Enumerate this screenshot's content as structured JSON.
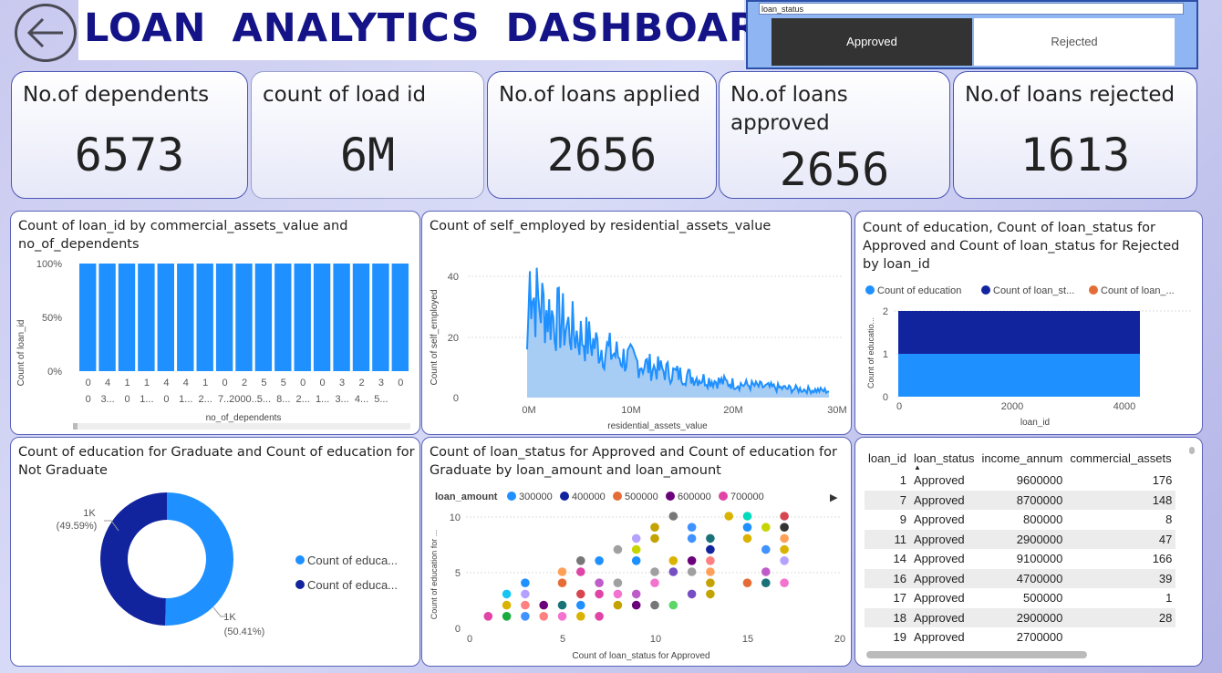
{
  "header": {
    "title": "LOAN  ANALYTICS  DASHBOARD",
    "back_icon": "back-arrow-icon"
  },
  "slicer": {
    "field": "loan_status",
    "options": [
      "Approved",
      "Rejected"
    ],
    "selected": "Approved"
  },
  "kpis": [
    {
      "label": "No.of dependents",
      "value": "6573"
    },
    {
      "label": "count of load id",
      "value": "6M"
    },
    {
      "label": "No.of loans applied",
      "value": "2656"
    },
    {
      "label": "No.of loans approved",
      "value": "2656"
    },
    {
      "label": "No.of loans rejected",
      "value": "1613"
    }
  ],
  "bar_chart": {
    "title": "Count of loan_id by commercial_assets_value and no_of_dependents",
    "ylabel": "Count of loan_id",
    "xlabel": "no_of_dependents",
    "yticks": [
      "100%",
      "50%",
      "0%"
    ],
    "cat_top": [
      "0",
      "4",
      "1",
      "1",
      "4",
      "4",
      "1",
      "0",
      "2",
      "5",
      "5",
      "0",
      "0",
      "3",
      "2",
      "3",
      "0"
    ],
    "cat_bot": [
      "0",
      "3...",
      "0",
      "1...",
      "0",
      "1...",
      "2...",
      "7...",
      "2000...",
      "5...",
      "8...",
      "2...",
      "1...",
      "3...",
      "4...",
      "5..."
    ],
    "values_pct": [
      100,
      100,
      100,
      100,
      100,
      100,
      100,
      100,
      100,
      100,
      100,
      100,
      100,
      100,
      100,
      100,
      100
    ],
    "color": "#1e90ff"
  },
  "area_chart": {
    "title": "Count of self_employed by residential_assets_value",
    "ylabel": "Count of self_employed",
    "xlabel": "residential_assets_value",
    "yticks": [
      "40",
      "20",
      "0"
    ],
    "xticks": [
      "0M",
      "10M",
      "20M",
      "30M"
    ],
    "color": "#1e90ff"
  },
  "stacked_chart": {
    "title": "Count of education, Count of loan_status for Approved and Count of loan_status for Rejected by loan_id",
    "legend": [
      "Count of  education",
      "Count of  loan_st...",
      "Count of  loan_..."
    ],
    "legend_colors": [
      "#1e90ff",
      "#12239e",
      "#e66c37"
    ],
    "ylabel": "Count of educatio...",
    "xlabel": "loan_id",
    "yticks": [
      "2",
      "1",
      "0"
    ],
    "xticks": [
      "0",
      "2000",
      "4000"
    ]
  },
  "donut": {
    "title": "Count of education for Graduate and Count of education for Not Graduate",
    "slices": [
      {
        "label": "1K",
        "pct": "(49.59%)",
        "value": 49.59,
        "color": "#12239e"
      },
      {
        "label": "1K",
        "pct": "(50.41%)",
        "value": 50.41,
        "color": "#1e90ff"
      }
    ],
    "legend": [
      "Count of  educa...",
      "Count of  educa..."
    ]
  },
  "scatter": {
    "title": "Count of loan_status for Approved and Count of education for Graduate by loan_amount and loan_amount",
    "legend_title": "loan_amount",
    "legend": [
      {
        "label": "300000",
        "color": "#1e90ff"
      },
      {
        "label": "400000",
        "color": "#12239e"
      },
      {
        "label": "500000",
        "color": "#e66c37"
      },
      {
        "label": "600000",
        "color": "#6b007b"
      },
      {
        "label": "700000",
        "color": "#e044a7"
      }
    ],
    "ylabel": "Count of education for ...",
    "xlabel": "Count of loan_status for Approved",
    "yticks": [
      "10",
      "5",
      "0"
    ],
    "xticks": [
      "0",
      "5",
      "10",
      "15",
      "20"
    ]
  },
  "table": {
    "columns": [
      "loan_id",
      "loan_status",
      "income_annum",
      "commercial_assets"
    ],
    "rows": [
      [
        "1",
        "Approved",
        "9600000",
        "176"
      ],
      [
        "7",
        "Approved",
        "8700000",
        "148"
      ],
      [
        "9",
        "Approved",
        "800000",
        "8"
      ],
      [
        "11",
        "Approved",
        "2900000",
        "47"
      ],
      [
        "14",
        "Approved",
        "9100000",
        "166"
      ],
      [
        "16",
        "Approved",
        "4700000",
        "39"
      ],
      [
        "17",
        "Approved",
        "500000",
        "1"
      ],
      [
        "18",
        "Approved",
        "2900000",
        "28"
      ],
      [
        "19",
        "Approved",
        "2700000",
        ""
      ]
    ]
  }
}
